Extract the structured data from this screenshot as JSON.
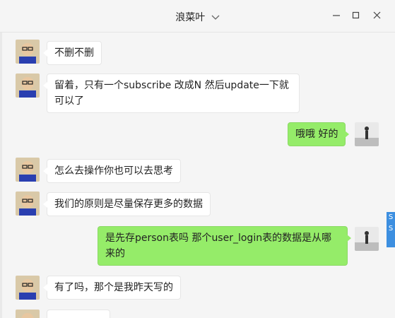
{
  "window": {
    "title": "浪菜叶",
    "controls": [
      "minimize-icon",
      "maximize-icon",
      "close-icon"
    ]
  },
  "messages": [
    {
      "side": "left",
      "text": "不删不删"
    },
    {
      "side": "left",
      "text": "留着，只有一个subscribe 改成N 然后update一下就可以了"
    },
    {
      "side": "right",
      "text": "哦哦  好的"
    },
    {
      "side": "left",
      "text": "怎么去操作你也可以去思考"
    },
    {
      "side": "left",
      "text": "我们的原则是尽量保存更多的数据"
    },
    {
      "side": "right",
      "text": "是先存person表吗  那个user_login表的数据是从哪来的"
    },
    {
      "side": "left",
      "text": "有了吗，那个是我昨天写的"
    }
  ],
  "side_tab": {
    "text": "S S"
  },
  "colors": {
    "self_bubble": "#95ec69",
    "other_bubble": "#ffffff",
    "background": "#f5f5f5",
    "side_tab": "#3d8fe0"
  }
}
